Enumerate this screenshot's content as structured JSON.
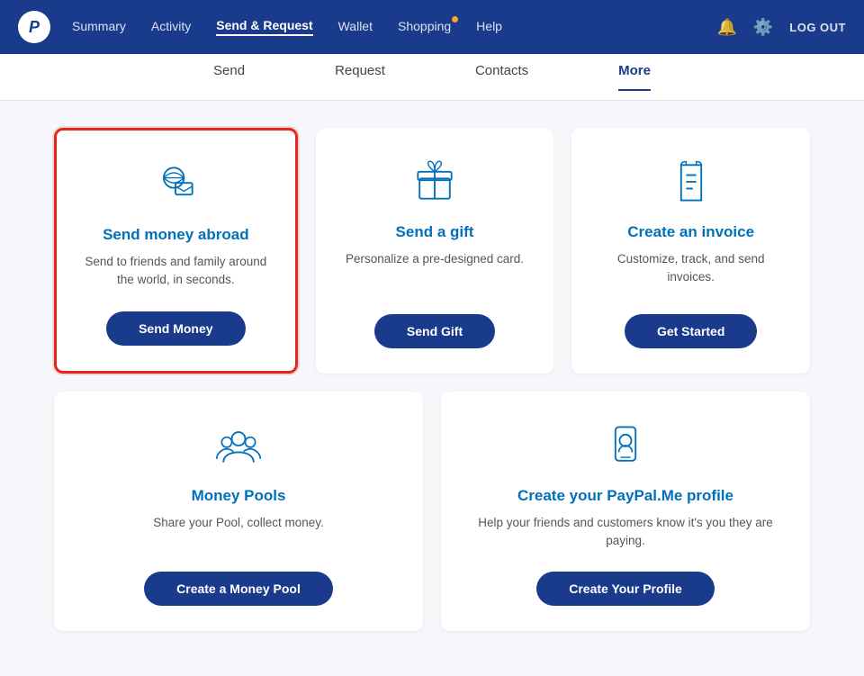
{
  "nav": {
    "logo_letter": "P",
    "links": [
      {
        "label": "Summary",
        "active": false
      },
      {
        "label": "Activity",
        "active": false
      },
      {
        "label": "Send & Request",
        "active": true,
        "dot": false
      },
      {
        "label": "Wallet",
        "active": false
      },
      {
        "label": "Shopping",
        "active": false,
        "dot": true
      },
      {
        "label": "Help",
        "active": false
      }
    ],
    "logout_label": "LOG OUT"
  },
  "sub_nav": {
    "items": [
      {
        "label": "Send",
        "active": false
      },
      {
        "label": "Request",
        "active": false
      },
      {
        "label": "Contacts",
        "active": false
      },
      {
        "label": "More",
        "active": true
      }
    ]
  },
  "cards": {
    "top_row": [
      {
        "id": "send-abroad",
        "title": "Send money abroad",
        "desc": "Send to friends and family around the world, in seconds.",
        "btn_label": "Send Money",
        "highlighted": true
      },
      {
        "id": "send-gift",
        "title": "Send a gift",
        "desc": "Personalize a pre-designed card.",
        "btn_label": "Send Gift",
        "highlighted": false
      },
      {
        "id": "create-invoice",
        "title": "Create an invoice",
        "desc": "Customize, track, and send invoices.",
        "btn_label": "Get Started",
        "highlighted": false
      }
    ],
    "bottom_row": [
      {
        "id": "money-pools",
        "title": "Money Pools",
        "desc": "Share your Pool, collect money.",
        "btn_label": "Create a Money Pool",
        "highlighted": false
      },
      {
        "id": "paypal-me",
        "title": "Create your PayPal.Me profile",
        "desc": "Help your friends and customers know it's you they are paying.",
        "btn_label": "Create Your Profile",
        "highlighted": false
      }
    ]
  }
}
